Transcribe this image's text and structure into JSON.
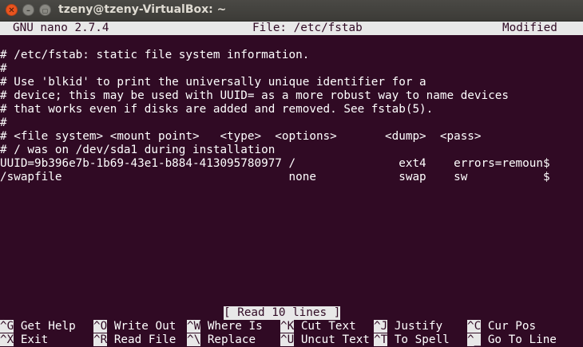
{
  "window": {
    "title": "tzeny@tzeny-VirtualBox: ~"
  },
  "nano": {
    "version": "GNU nano 2.7.4",
    "file_label": "File: /etc/fstab",
    "state": "Modified"
  },
  "lines": [
    "",
    "# /etc/fstab: static file system information.",
    "#",
    "# Use 'blkid' to print the universally unique identifier for a",
    "# device; this may be used with UUID= as a more robust way to name devices",
    "# that works even if disks are added and removed. See fstab(5).",
    "#",
    "# <file system> <mount point>   <type>  <options>       <dump>  <pass>",
    "# / was on /dev/sda1 during installation",
    "UUID=9b396e7b-1b69-43e1-b884-413095780977 /               ext4    errors=remoun$",
    "/swapfile                                 none            swap    sw           $"
  ],
  "status_message": "[ Read 10 lines ]",
  "shortcuts": [
    {
      "key": "^G",
      "label": "Get Help"
    },
    {
      "key": "^O",
      "label": "Write Out"
    },
    {
      "key": "^W",
      "label": "Where Is"
    },
    {
      "key": "^K",
      "label": "Cut Text"
    },
    {
      "key": "^J",
      "label": "Justify"
    },
    {
      "key": "^C",
      "label": "Cur Pos"
    },
    {
      "key": "^X",
      "label": "Exit"
    },
    {
      "key": "^R",
      "label": "Read File"
    },
    {
      "key": "^\\",
      "label": "Replace"
    },
    {
      "key": "^U",
      "label": "Uncut Text"
    },
    {
      "key": "^T",
      "label": "To Spell"
    },
    {
      "key": "^_",
      "label": "Go To Line"
    }
  ]
}
